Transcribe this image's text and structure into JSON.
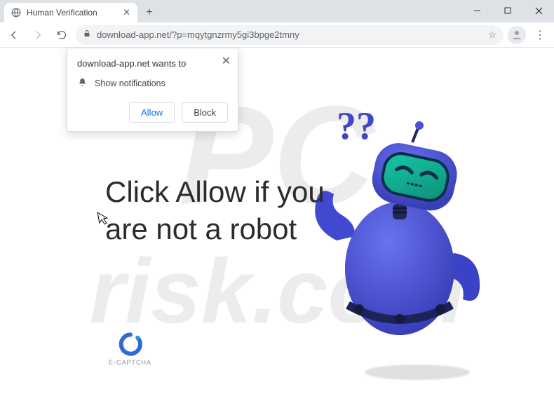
{
  "window": {
    "tab_title": "Human Verification",
    "url_display": "download-app.net/?p=mqytgnzrmy5gi3bpge2tmny"
  },
  "permission_prompt": {
    "origin_text": "download-app.net wants to",
    "request_text": "Show notifications",
    "allow_label": "Allow",
    "block_label": "Block"
  },
  "page": {
    "headline": "Click Allow if you are not a robot",
    "captcha_label": "E-CAPTCHA",
    "question_marks": "??"
  },
  "watermark": {
    "line1": "PC",
    "line2": "risk.com"
  }
}
